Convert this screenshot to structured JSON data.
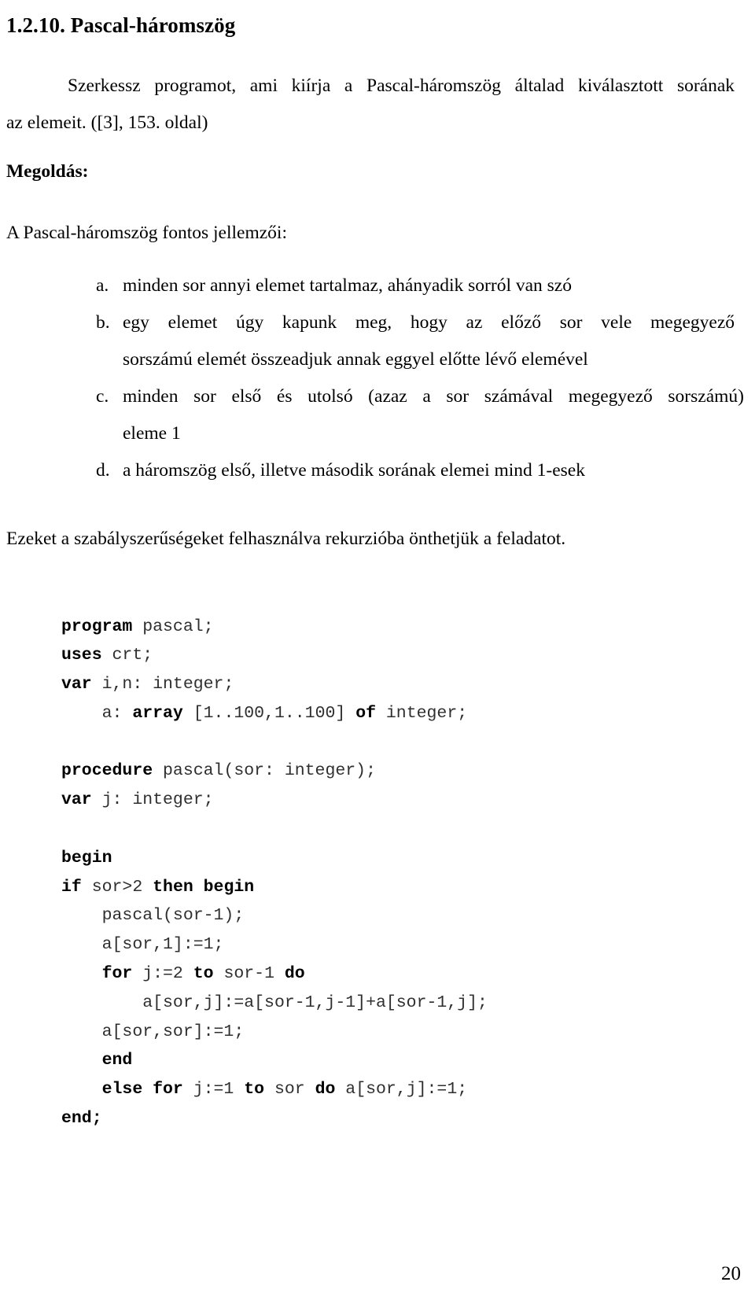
{
  "document": {
    "title": "1.2.10. Pascal-háromszög",
    "intro_line1": "Szerkessz programot, ami kiírja a Pascal-háromszög általad kiválasztott sorának",
    "intro_line2": "az elemeit. ([3], 153. oldal)",
    "solution_label": "Megoldás:",
    "lead_in": "A Pascal-háromszög fontos jellemzői:",
    "summary": "Ezeket a szabályszerűségeket felhasználva rekurzióba önthetjük a feladatot.",
    "page_number": "20"
  },
  "list": {
    "items": [
      {
        "marker": "a.",
        "line1": "minden sor annyi elemet tartalmaz, ahányadik sorról van szó",
        "line2": ""
      },
      {
        "marker": "b.",
        "line1": "egy elemet úgy kapunk meg, hogy az előző sor vele megegyező",
        "line2": "sorszámú elemét összeadjuk annak eggyel előtte lévő elemével"
      },
      {
        "marker": "c.",
        "line1": "minden sor első és utolsó (azaz a sor számával megegyező sorszámú)",
        "line2": "eleme 1"
      },
      {
        "marker": "d.",
        "line1": "a háromszög első, illetve második sorának elemei mind 1-esek",
        "line2": ""
      }
    ]
  },
  "code": {
    "language": "pascal",
    "lines": [
      {
        "indent": 0,
        "tokens": [
          {
            "t": "program",
            "kw": true
          },
          {
            "t": " pascal;",
            "kw": false
          }
        ]
      },
      {
        "indent": 0,
        "tokens": [
          {
            "t": "uses",
            "kw": true
          },
          {
            "t": " crt;",
            "kw": false
          }
        ]
      },
      {
        "indent": 0,
        "tokens": [
          {
            "t": "var",
            "kw": true
          },
          {
            "t": " i,n: integer;",
            "kw": false
          }
        ]
      },
      {
        "indent": 4,
        "tokens": [
          {
            "t": "a: ",
            "kw": false
          },
          {
            "t": "array",
            "kw": true
          },
          {
            "t": " [1..100,1..100] ",
            "kw": false
          },
          {
            "t": "of",
            "kw": true
          },
          {
            "t": " integer;",
            "kw": false
          }
        ]
      },
      {
        "indent": 0,
        "tokens": []
      },
      {
        "indent": 0,
        "tokens": [
          {
            "t": "procedure",
            "kw": true
          },
          {
            "t": " pascal(sor: integer);",
            "kw": false
          }
        ]
      },
      {
        "indent": 0,
        "tokens": [
          {
            "t": "var",
            "kw": true
          },
          {
            "t": " j: integer;",
            "kw": false
          }
        ]
      },
      {
        "indent": 0,
        "tokens": []
      },
      {
        "indent": 0,
        "tokens": [
          {
            "t": "begin",
            "kw": true
          }
        ]
      },
      {
        "indent": 0,
        "tokens": [
          {
            "t": "if",
            "kw": true
          },
          {
            "t": " sor>2 ",
            "kw": false
          },
          {
            "t": "then begin",
            "kw": true
          }
        ]
      },
      {
        "indent": 4,
        "tokens": [
          {
            "t": "pascal(sor-1);",
            "kw": false
          }
        ]
      },
      {
        "indent": 4,
        "tokens": [
          {
            "t": "a[sor,1]:=1;",
            "kw": false
          }
        ]
      },
      {
        "indent": 4,
        "tokens": [
          {
            "t": "for",
            "kw": true
          },
          {
            "t": " j:=2 ",
            "kw": false
          },
          {
            "t": "to",
            "kw": true
          },
          {
            "t": " sor-1 ",
            "kw": false
          },
          {
            "t": "do",
            "kw": true
          }
        ]
      },
      {
        "indent": 8,
        "tokens": [
          {
            "t": "a[sor,j]:=a[sor-1,j-1]+a[sor-1,j];",
            "kw": false
          }
        ]
      },
      {
        "indent": 4,
        "tokens": [
          {
            "t": "a[sor,sor]:=1;",
            "kw": false
          }
        ]
      },
      {
        "indent": 4,
        "tokens": [
          {
            "t": "end",
            "kw": true
          }
        ]
      },
      {
        "indent": 4,
        "tokens": [
          {
            "t": "else for",
            "kw": true
          },
          {
            "t": " j:=1 ",
            "kw": false
          },
          {
            "t": "to",
            "kw": true
          },
          {
            "t": " sor ",
            "kw": false
          },
          {
            "t": "do",
            "kw": true
          },
          {
            "t": " a[sor,j]:=1;",
            "kw": false
          }
        ]
      },
      {
        "indent": 0,
        "tokens": [
          {
            "t": "end;",
            "kw": true
          }
        ]
      }
    ]
  }
}
